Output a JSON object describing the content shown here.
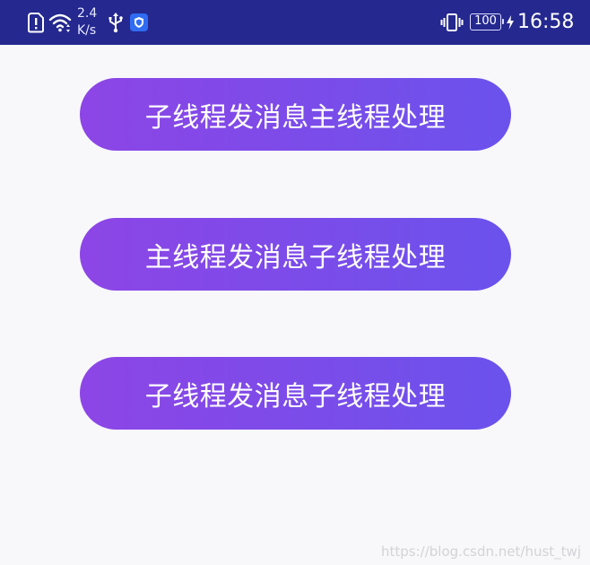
{
  "status_bar": {
    "net_speed_value": "2.4",
    "net_speed_unit": "K/s",
    "battery_level": "100",
    "time": "16:58",
    "icons": [
      "sim-alert-icon",
      "wifi-icon",
      "usb-icon",
      "shield-app-icon",
      "vibrate-icon",
      "battery-icon",
      "charging-icon"
    ]
  },
  "buttons": {
    "b1_label": "子线程发消息主线程处理",
    "b2_label": "主线程发消息子线程处理",
    "b3_label": "子线程发消息子线程处理"
  },
  "watermark": "https://blog.csdn.net/hust_twj",
  "colors": {
    "status_bar": "#24288f",
    "background": "#f8f8fa",
    "button_gradient_start": "#8d45e6",
    "button_gradient_end": "#6b52ec"
  }
}
